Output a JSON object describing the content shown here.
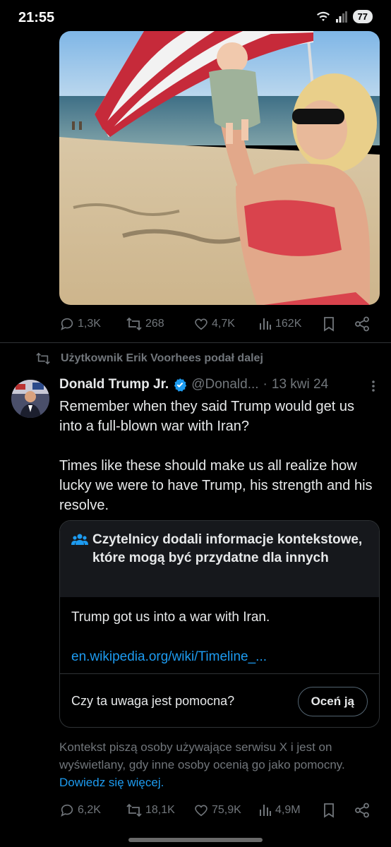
{
  "status_bar": {
    "time": "21:55",
    "battery": "77",
    "icons": [
      "wifi-icon",
      "signal-icon"
    ]
  },
  "prev_tweet": {
    "image": "photo-woman-holding-baby-on-beach-with-flag",
    "actions": {
      "replies": "1,3K",
      "reposts": "268",
      "likes": "4,7K",
      "views": "162K"
    }
  },
  "repost_line": "Użytkownik Erik Voorhees podał dalej",
  "tweet": {
    "author_name": "Donald Trump Jr.",
    "handle": "@Donald...",
    "separator": "·",
    "date": "13 kwi 24",
    "text_p1": "Remember when they said Trump would get us into a full-blown war with Iran?",
    "text_p2": "Times like these should make us all realize how lucky we were to have Trump, his strength and his resolve.",
    "actions": {
      "replies": "6,2K",
      "reposts": "18,1K",
      "likes": "75,9K",
      "views": "4,9M"
    }
  },
  "community_note": {
    "title": "Czytelnicy dodali informacje kontekstowe, które mogą być przydatne dla innych",
    "text": "Trump got us into a war with Iran.",
    "link": "en.wikipedia.org/wiki/Timeline_...",
    "question": "Czy ta uwaga jest pomocna?",
    "rate_button": "Oceń ją"
  },
  "note_info": {
    "text": "Kontekst piszą osoby używające serwisu X i jest on wyświetlany, gdy inne osoby ocenią go jako pomocny.",
    "learn_more": "Dowiedz się więcej."
  },
  "colors": {
    "background": "#000000",
    "text": "#e7e9ea",
    "muted": "#71767b",
    "link": "#1d9bf0",
    "verified": "#1d9bf0"
  }
}
